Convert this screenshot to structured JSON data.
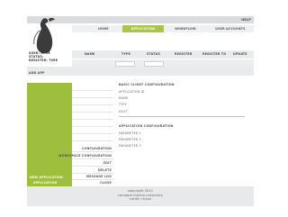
{
  "header": {
    "help": "HELP"
  },
  "nav": {
    "tabs": [
      {
        "label": "HOME",
        "active": false
      },
      {
        "label": "APPLICATION",
        "active": true
      },
      {
        "label": "WORKFLOW",
        "active": false
      },
      {
        "label": "USER ACCOUNTS",
        "active": false
      }
    ]
  },
  "left": {
    "lines": [
      "USER: HPCE",
      "STATUS:",
      "REGISTER: TIME"
    ],
    "add_button": "ADD APP"
  },
  "table": {
    "columns": [
      "NAME",
      "TYPE",
      "STATUS",
      "REGISTER",
      "REGISTER TO",
      "UPDATE"
    ]
  },
  "list": {
    "items": [
      "CONFIGURATION",
      "WORKSPACE CONFIGURATION",
      "EDIT",
      "DELETE",
      "MESSAGE LOG",
      "CLOSE"
    ]
  },
  "sidebar_green": {
    "items": [
      "NEW APPLICATION",
      "APPLICATION"
    ]
  },
  "detail": {
    "basic_heading": "BASIC CLIENT CONFIGURATION",
    "basic_fields": [
      "APPLICATION ID",
      "NAME",
      "TYPE",
      "HOST"
    ],
    "app_heading": "APPLICATION CONFIGURATION",
    "app_fields": [
      "PARAMETER 1",
      "PARAMETER 2",
      "PARAMETER 3"
    ]
  },
  "footer": {
    "lines": [
      "copyright 2011",
      "carnegie mellon university",
      "credit: rf/xxx"
    ]
  },
  "colors": {
    "accent_green": "#9ebf3e",
    "band_gray": "#e8eaeb"
  }
}
